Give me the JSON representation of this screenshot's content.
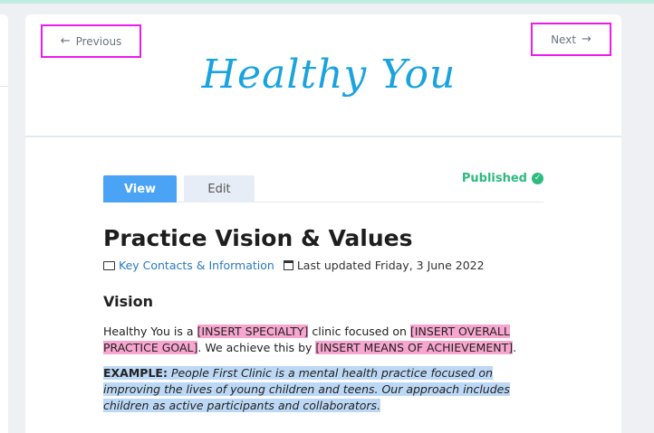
{
  "nav": {
    "previous_label": "Previous",
    "next_label": "Next"
  },
  "logo": {
    "text": "Healthy You"
  },
  "tabs": [
    {
      "label": "View",
      "active": true
    },
    {
      "label": "Edit",
      "active": false
    }
  ],
  "status": {
    "label": "Published",
    "color": "#2dbb7f"
  },
  "page": {
    "title": "Practice Vision & Values",
    "category_link": "Key Contacts & Information",
    "last_updated": "Last updated Friday, 3 June 2022"
  },
  "vision": {
    "heading": "Vision",
    "text_1": "Healthy You is a ",
    "placeholder_1": "[INSERT SPECIALTY]",
    "text_2": " clinic focused on ",
    "placeholder_2": "[INSERT OVERALL PRACTICE GOAL]",
    "text_3": ". We achieve this by ",
    "placeholder_3": "[INSERT MEANS OF ACHIEVEMENT]",
    "text_4": ".",
    "example_label": "EXAMPLE:",
    "example_text": " People First Clinic is a mental health practice focused on improving the lives of young children and teens. Our approach includes children as active participants and collaborators."
  },
  "colors": {
    "accent": "#4aa3f5",
    "logo": "#1aa3df",
    "highlight_placeholder": "#f7a6cf",
    "highlight_example": "#bcd8f5",
    "nav_outline": "#ee1bee"
  },
  "icons": [
    "arrow-left-icon",
    "arrow-right-icon",
    "check-circle-icon",
    "folder-icon",
    "calendar-icon"
  ]
}
